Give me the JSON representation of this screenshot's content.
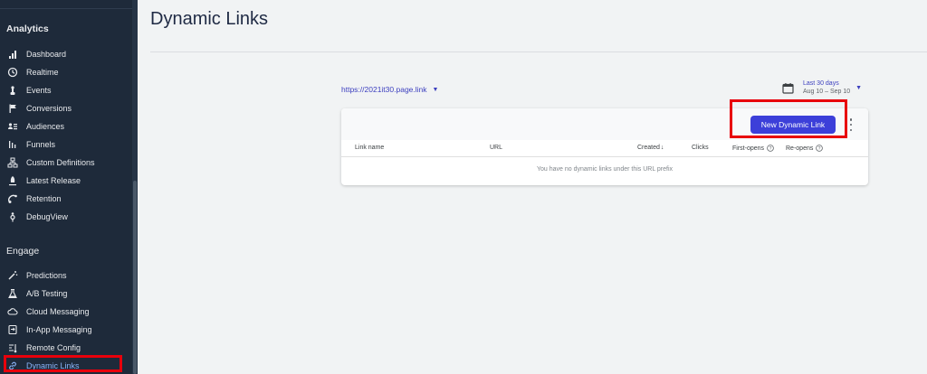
{
  "sidebar": {
    "analytics_title": "Analytics",
    "analytics_items": [
      {
        "label": "Dashboard",
        "icon": "bar-chart-icon"
      },
      {
        "label": "Realtime",
        "icon": "clock-icon"
      },
      {
        "label": "Events",
        "icon": "touch-icon"
      },
      {
        "label": "Conversions",
        "icon": "flag-icon"
      },
      {
        "label": "Audiences",
        "icon": "people-list-icon"
      },
      {
        "label": "Funnels",
        "icon": "funnel-icon"
      },
      {
        "label": "Custom Definitions",
        "icon": "hierarchy-icon"
      },
      {
        "label": "Latest Release",
        "icon": "rocket-icon"
      },
      {
        "label": "Retention",
        "icon": "retention-icon"
      },
      {
        "label": "DebugView",
        "icon": "debug-icon"
      }
    ],
    "engage_title": "Engage",
    "engage_items": [
      {
        "label": "Predictions",
        "icon": "magic-wand-icon"
      },
      {
        "label": "A/B Testing",
        "icon": "flask-icon"
      },
      {
        "label": "Cloud Messaging",
        "icon": "cloud-message-icon"
      },
      {
        "label": "In-App Messaging",
        "icon": "in-app-message-icon"
      },
      {
        "label": "Remote Config",
        "icon": "remote-config-icon"
      },
      {
        "label": "Dynamic Links",
        "icon": "link-icon",
        "active": true
      }
    ]
  },
  "page": {
    "title": "Dynamic Links"
  },
  "url_prefix": {
    "value": "https://2021it30.page.link"
  },
  "date_range": {
    "label": "Last 30 days",
    "range": "Aug 10 – Sep 10"
  },
  "toolbar": {
    "new_link_label": "New Dynamic Link"
  },
  "table": {
    "columns": {
      "link_name": "Link name",
      "url": "URL",
      "created": "Created",
      "created_sort": "↓",
      "clicks": "Clicks",
      "first_opens": "First-opens",
      "re_opens": "Re-opens"
    },
    "empty_message": "You have no dynamic links under this URL prefix"
  },
  "colors": {
    "sidebar_bg": "#1e2a3a",
    "accent": "#3c3fd9",
    "highlight_box": "#e8000b",
    "active_nav": "#8ab4f8"
  }
}
